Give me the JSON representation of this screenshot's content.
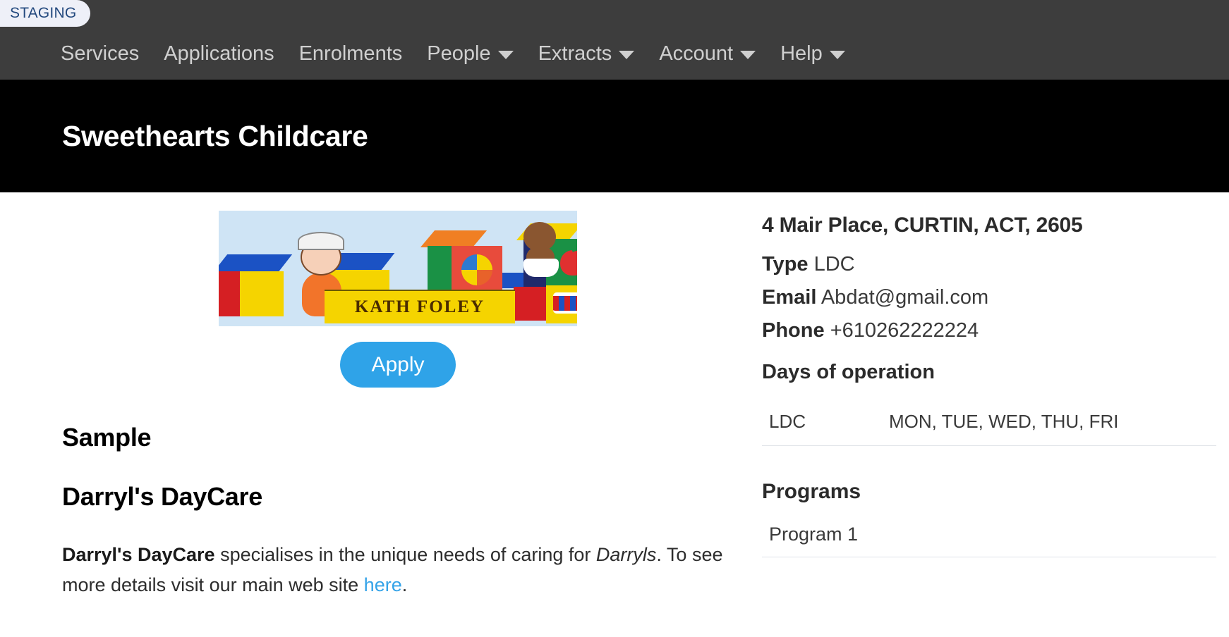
{
  "staging_badge": "STAGING",
  "nav": {
    "items": [
      {
        "label": "Services",
        "has_caret": false
      },
      {
        "label": "Applications",
        "has_caret": false
      },
      {
        "label": "Enrolments",
        "has_caret": false
      },
      {
        "label": "People",
        "has_caret": true
      },
      {
        "label": "Extracts",
        "has_caret": true
      },
      {
        "label": "Account",
        "has_caret": true
      },
      {
        "label": "Help",
        "has_caret": true
      }
    ]
  },
  "banner": {
    "title": "Sweethearts Childcare"
  },
  "logo": {
    "text": "KATH FOLEY",
    "alt": "Kath Foley childcare blocks logo"
  },
  "apply": {
    "label": "Apply"
  },
  "content": {
    "heading_1": "Sample",
    "heading_2": "Darryl's DayCare",
    "paragraph": {
      "bold_lead": "Darryl's DayCare",
      "part_1": " specialises in the unique needs of caring for ",
      "italic": "Darryls",
      "part_2": ". To see more details visit our main web site ",
      "link": "here",
      "part_3": "."
    }
  },
  "details": {
    "address": "4 Mair Place, CURTIN, ACT, 2605",
    "type_label": "Type",
    "type_value": "LDC",
    "email_label": "Email",
    "email_value": "Abdat@gmail.com",
    "phone_label": "Phone",
    "phone_value": "+610262222224",
    "days_label": "Days of operation",
    "days_rows": [
      {
        "service": "LDC",
        "days": "MON, TUE, WED, THU, FRI"
      }
    ],
    "programs_label": "Programs",
    "programs": [
      {
        "name": "Program 1"
      }
    ]
  },
  "colors": {
    "navbar_bg": "#3d3d3d",
    "banner_bg": "#000000",
    "accent_blue": "#2fa3e8",
    "link_blue": "#34a3e8",
    "staging_bg": "#eef0f8",
    "staging_text": "#23497e"
  }
}
